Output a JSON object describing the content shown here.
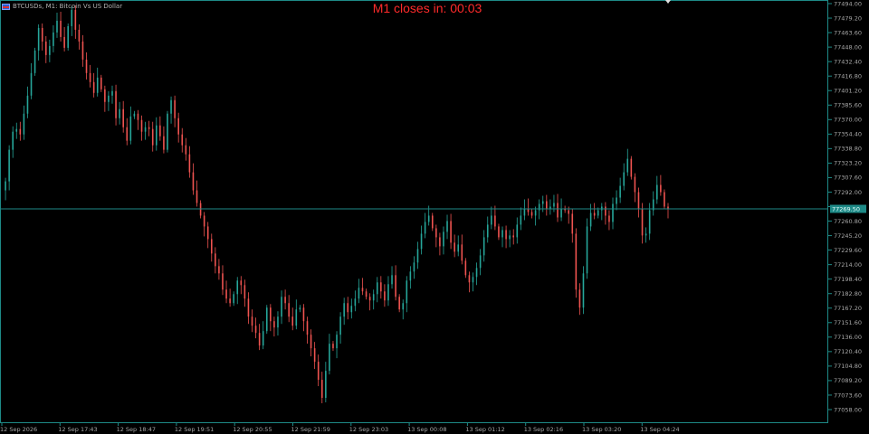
{
  "window": {
    "symbol_title": "BTCUSDs, M1:  Bitcoin Vs US Dollar",
    "flag_icon": "us-flag-icon"
  },
  "overlay": {
    "timer_text": "M1 closes in: 00:03",
    "timer_color": "#ff2a2a",
    "marker_icon": "chart-shift-marker-icon"
  },
  "colors": {
    "background": "#000000",
    "frame": "#1e8a87",
    "bull_candle": "#26a69a",
    "bear_candle": "#ef5350",
    "bid_line": "#1e8a87",
    "price_tag_bg": "#1e8a87",
    "axis_text": "#a8a8a8"
  },
  "chart_data": {
    "type": "line",
    "title": "",
    "xlabel": "",
    "ylabel": "",
    "ylim": [
      77048,
      77497
    ],
    "y_ticks": [
      "77494.00",
      "77479.20",
      "77463.60",
      "77448.00",
      "77432.40",
      "77416.80",
      "77401.20",
      "77385.60",
      "77370.00",
      "77354.40",
      "77338.80",
      "77323.20",
      "77307.60",
      "77292.00",
      "77276.40",
      "77260.80",
      "77245.20",
      "77229.60",
      "77214.00",
      "77198.40",
      "77182.80",
      "77167.20",
      "77151.60",
      "77136.00",
      "77120.40",
      "77104.80",
      "77089.20",
      "77073.60",
      "77058.00"
    ],
    "x_ticks": [
      "12 Sep 2026",
      "12 Sep 17:43",
      "12 Sep 18:47",
      "12 Sep 19:51",
      "12 Sep 20:55",
      "12 Sep 21:59",
      "12 Sep 23:03",
      "13 Sep 00:08",
      "13 Sep 01:12",
      "13 Sep 02:16",
      "13 Sep 03:20",
      "13 Sep 04:24"
    ],
    "current_price": "77269.50",
    "current_value": 77269.5,
    "series": [
      {
        "values": [
          77290,
          77300,
          77335,
          77355,
          77358,
          77352,
          77375,
          77395,
          77420,
          77445,
          77470,
          77455,
          77440,
          77450,
          77465,
          77478,
          77460,
          77448,
          77472,
          77490,
          77468,
          77455,
          77435,
          77420,
          77410,
          77398,
          77415,
          77402,
          77388,
          77395,
          77400,
          77370,
          77380,
          77360,
          77345,
          77372,
          77375,
          77368,
          77355,
          77360,
          77358,
          77340,
          77362,
          77350,
          77335,
          77375,
          77390,
          77370,
          77352,
          77340,
          77330,
          77310,
          77290,
          77276,
          77262,
          77250,
          77236,
          77220,
          77206,
          77198,
          77180,
          77170,
          77165,
          77175,
          77190,
          77185,
          77170,
          77150,
          77140,
          77132,
          77118,
          77134,
          77160,
          77145,
          77138,
          77150,
          77172,
          77165,
          77150,
          77140,
          77158,
          77160,
          77145,
          77130,
          77115,
          77100,
          77080,
          77060,
          77090,
          77120,
          77115,
          77130,
          77150,
          77165,
          77155,
          77162,
          77170,
          77182,
          77178,
          77172,
          77168,
          77175,
          77188,
          77178,
          77168,
          77186,
          77196,
          77172,
          77158,
          77165,
          77190,
          77200,
          77210,
          77225,
          77242,
          77255,
          77262,
          77248,
          77238,
          77228,
          77244,
          77256,
          77232,
          77222,
          77230,
          77212,
          77196,
          77188,
          77194,
          77204,
          77218,
          77238,
          77252,
          77262,
          77250,
          77238,
          77246,
          77236,
          77240,
          77238,
          77252,
          77262,
          77270,
          77266,
          77262,
          77268,
          77275,
          77278,
          77270,
          77272,
          77276,
          77260,
          77270,
          77268,
          77264,
          77242,
          77180,
          77160,
          77198,
          77250,
          77265,
          77262,
          77268,
          77272,
          77262,
          77255,
          77275,
          77282,
          77295,
          77310,
          77325,
          77305,
          77288,
          77270,
          77240,
          77242,
          77268,
          77280,
          77296,
          77288,
          77272,
          77270
        ]
      }
    ]
  }
}
